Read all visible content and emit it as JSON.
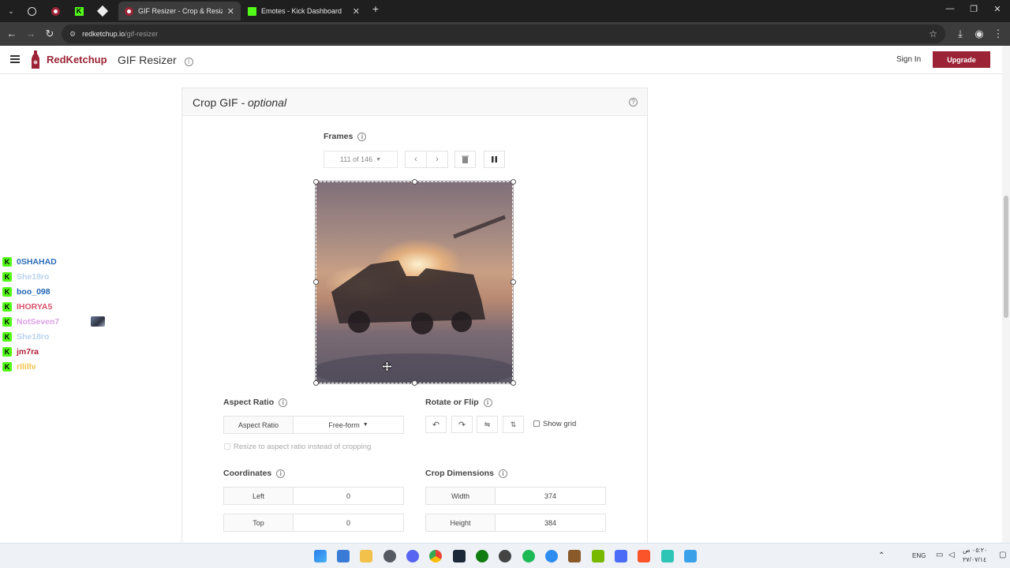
{
  "browser": {
    "tabs": [
      {
        "title": "GIF Resizer - Crop & Resize Ani",
        "active": true
      },
      {
        "title": "Emotes - Kick Dashboard",
        "active": false
      }
    ],
    "url_host": "redketchup.io",
    "url_path": "/gif-resizer"
  },
  "header": {
    "brand": "RedKetchup",
    "app_title": "GIF Resizer",
    "sign_in": "Sign In",
    "upgrade": "Upgrade"
  },
  "chat": {
    "badge": "K",
    "items": [
      {
        "name": "0SHAHAD",
        "color": "#2a6db5"
      },
      {
        "name": "She18ro",
        "color": "#b9d3ef"
      },
      {
        "name": "boo_098",
        "color": "#1e63b3"
      },
      {
        "name": "IHORYA5",
        "color": "#d9536b"
      },
      {
        "name": "NotSeven7",
        "color": "#dba1e6"
      },
      {
        "name": "She18ro",
        "color": "#b9d3ef"
      },
      {
        "name": "jm7ra",
        "color": "#b01e3a"
      },
      {
        "name": "rIlillv",
        "color": "#f0c24a"
      }
    ]
  },
  "crop": {
    "title": "Crop GIF",
    "title_suffix": " - optional",
    "frames_label": "Frames",
    "frame_select": "111 of 146",
    "aspect_ratio_label": "Aspect Ratio",
    "aspect_ratio_field": "Aspect Ratio",
    "aspect_ratio_value": "Free-form",
    "rotate_label": "Rotate or Flip",
    "show_grid": "Show grid",
    "resize_option": "Resize to aspect ratio instead of cropping",
    "coordinates_label": "Coordinates",
    "left_label": "Left",
    "left_value": "0",
    "top_label": "Top",
    "top_value": "0",
    "dimensions_label": "Crop Dimensions",
    "width_label": "Width",
    "width_value": "374",
    "height_label": "Height",
    "height_value": "384"
  },
  "taskbar": {
    "lang": "ENG",
    "time": "٠٥:٢٠ ص",
    "date": "٢٧/٠٧/١٤"
  },
  "colors": {
    "brand": "#9b2335",
    "kick_green": "#53fc18"
  }
}
